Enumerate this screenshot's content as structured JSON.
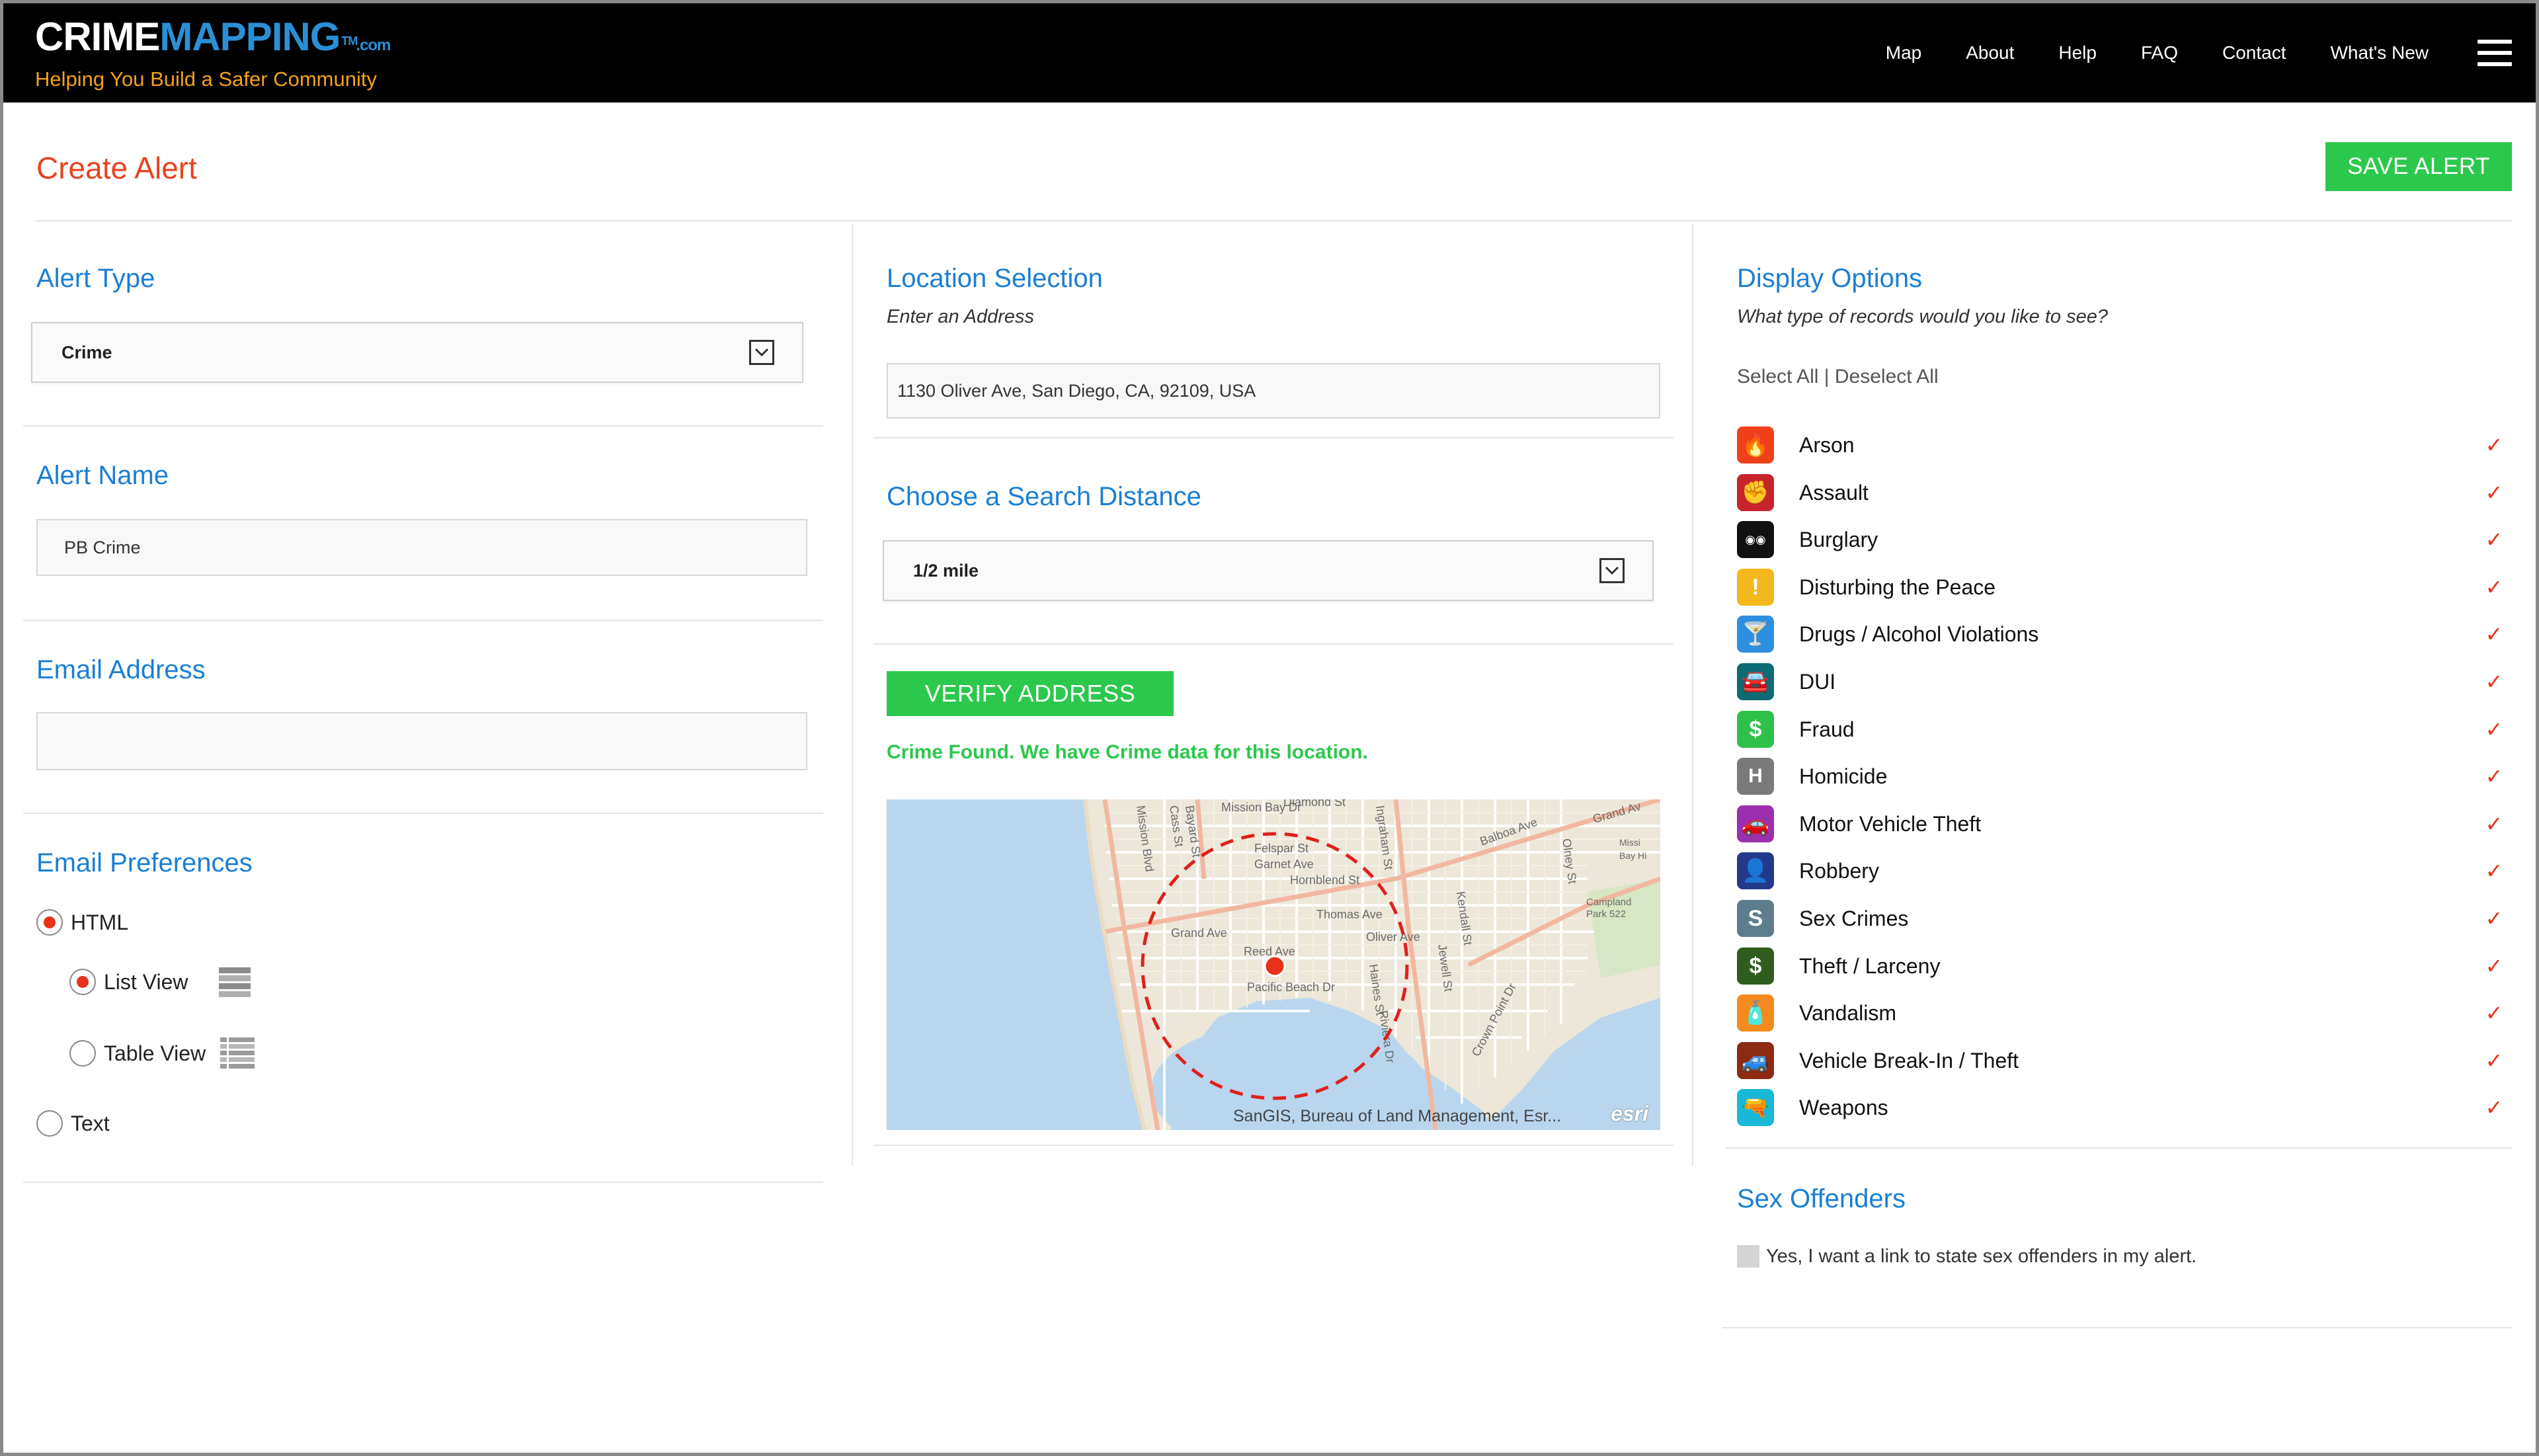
{
  "header": {
    "logo_part1": "CRIME",
    "logo_part2": "MAPPING",
    "logo_tm": "TM",
    "logo_com": ".com",
    "tagline": "Helping You Build a Safer Community",
    "nav": [
      "Map",
      "About",
      "Help",
      "FAQ",
      "Contact",
      "What's New"
    ],
    "menu_icon": "hamburger-menu-icon"
  },
  "page": {
    "title": "Create Alert",
    "save_label": "SAVE ALERT"
  },
  "alert_type": {
    "title": "Alert Type",
    "value": "Crime"
  },
  "alert_name": {
    "title": "Alert Name",
    "value": "PB Crime"
  },
  "email_address": {
    "title": "Email Address",
    "value": ""
  },
  "email_prefs": {
    "title": "Email Preferences",
    "html_label": "HTML",
    "list_view_label": "List View",
    "table_view_label": "Table View",
    "text_label": "Text",
    "selected_format": "HTML",
    "selected_view": "List View"
  },
  "location": {
    "title": "Location Selection",
    "subtitle": "Enter an Address",
    "address": "1130 Oliver Ave, San Diego, CA, 92109, USA"
  },
  "distance": {
    "title": "Choose a Search Distance",
    "value": "1/2 mile"
  },
  "verify": {
    "button_label": "VERIFY ADDRESS",
    "status": "Crime Found. We have Crime data for this location."
  },
  "map": {
    "attribution": "SanGIS, Bureau of Land Management, Esr...",
    "logo": "esri",
    "labels": [
      "Mission Bay Dr",
      "Cass St",
      "Bayard St",
      "Mission Bl",
      "Felspar St",
      "Garnet Ave",
      "Hornblend St",
      "Grand Ave",
      "Thomas Ave",
      "Reed Ave",
      "Pacific Beach Dr",
      "Oliver Ave",
      "Haines St",
      "Kendall St",
      "Jewell St",
      "Olney St",
      "Balboa Ave",
      "Grand Ave",
      "Crown Point Dr",
      "Riviera Dr",
      "Diamond St",
      "Ingraham St",
      "Campland Park 522",
      "Mission Bay Hi"
    ]
  },
  "display_options": {
    "title": "Display Options",
    "subtitle": "What type of records would you like to see?",
    "select_all": "Select All",
    "separator": "|",
    "deselect_all": "Deselect All",
    "categories": [
      {
        "label": "Arson",
        "icon": "flame-icon",
        "color": "#f0401a",
        "checked": true
      },
      {
        "label": "Assault",
        "icon": "fist-icon",
        "color": "#c7242c",
        "checked": true
      },
      {
        "label": "Burglary",
        "icon": "mask-icon",
        "color": "#111111",
        "checked": true
      },
      {
        "label": "Disturbing the Peace",
        "icon": "exclamation-icon",
        "color": "#f5b81c",
        "checked": true
      },
      {
        "label": "Drugs / Alcohol Violations",
        "icon": "cocktail-icon",
        "color": "#2d8fe0",
        "checked": true
      },
      {
        "label": "DUI",
        "icon": "car-front-icon",
        "color": "#0e6b74",
        "checked": true
      },
      {
        "label": "Fraud",
        "icon": "card-dollar-icon",
        "color": "#2fc04a",
        "checked": true
      },
      {
        "label": "Homicide",
        "icon": "h-circle-icon",
        "color": "#7a7a7a",
        "checked": true
      },
      {
        "label": "Motor Vehicle Theft",
        "icon": "car-icon",
        "color": "#9b2fae",
        "checked": true
      },
      {
        "label": "Robbery",
        "icon": "robber-icon",
        "color": "#233a8c",
        "checked": true
      },
      {
        "label": "Sex Crimes",
        "icon": "s-letter-icon",
        "color": "#5e7d8c",
        "checked": true
      },
      {
        "label": "Theft / Larceny",
        "icon": "dollar-icon",
        "color": "#2f5d1e",
        "checked": true
      },
      {
        "label": "Vandalism",
        "icon": "spray-can-icon",
        "color": "#f58a1f",
        "checked": true
      },
      {
        "label": "Vehicle Break-In / Theft",
        "icon": "car-break-in-icon",
        "color": "#8c2a12",
        "checked": true
      },
      {
        "label": "Weapons",
        "icon": "gun-icon",
        "color": "#1ab8d8",
        "checked": true
      }
    ],
    "check_icon": "checkmark-icon"
  },
  "sex_offenders": {
    "title": "Sex Offenders",
    "checkbox_label": "Yes, I want a link to state sex offenders in my alert.",
    "checked": false
  }
}
